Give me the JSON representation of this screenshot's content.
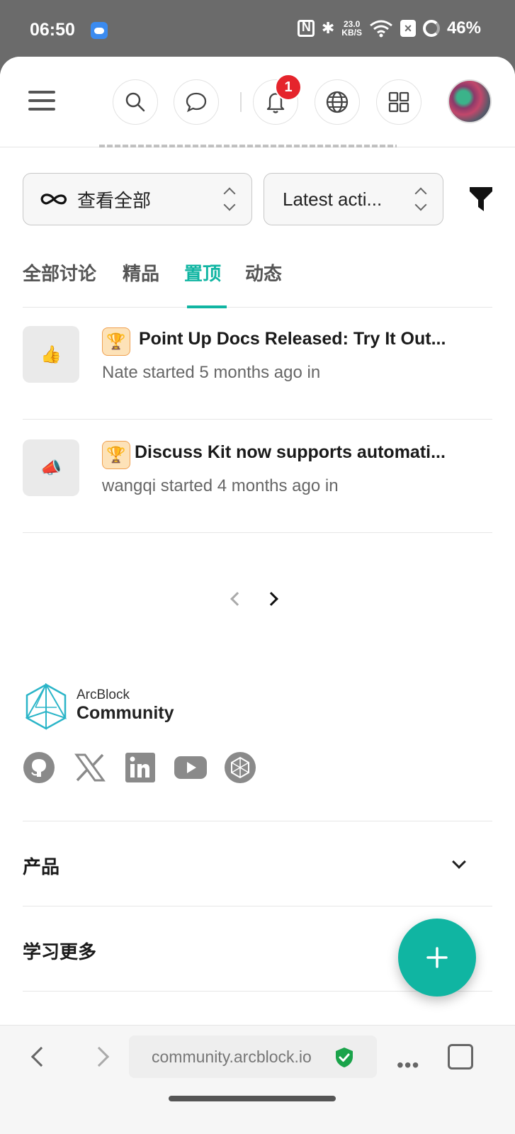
{
  "status_bar": {
    "time": "06:50",
    "speed_value": "23.0",
    "speed_unit": "KB/S",
    "battery": "46%"
  },
  "header": {
    "notification_count": "1"
  },
  "filters": {
    "scope_label": "查看全部",
    "sort_label": "Latest acti..."
  },
  "tabs": [
    {
      "label": "全部讨论"
    },
    {
      "label": "精品"
    },
    {
      "label": "置顶"
    },
    {
      "label": "动态"
    }
  ],
  "active_tab": "置顶",
  "posts": [
    {
      "icon": "👍",
      "title": "Point Up Docs Released: Try It Out...",
      "meta": "Nate started 5 months ago in"
    },
    {
      "icon": "📣",
      "title": "Discuss Kit now supports automati...",
      "meta": "wangqi started 4 months ago in"
    }
  ],
  "footer": {
    "brand_small": "ArcBlock",
    "brand_big": "Community",
    "social_icons": [
      "github-icon",
      "x-icon",
      "linkedin-icon",
      "youtube-icon",
      "arcblock-icon"
    ],
    "sections": [
      {
        "label": "产品"
      },
      {
        "label": "学习更多"
      }
    ]
  },
  "browser": {
    "url": "community.arcblock.io"
  },
  "colors": {
    "accent": "#10b5a2",
    "badge": "#e5242c",
    "status_bar": "#6b6b6b"
  }
}
